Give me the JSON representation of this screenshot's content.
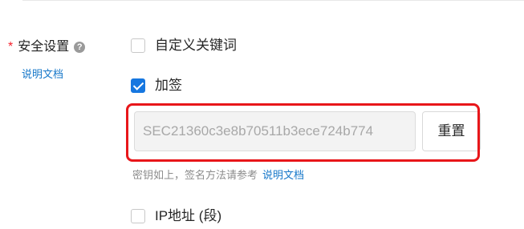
{
  "security_section": {
    "required_mark": "*",
    "label": "安全设置",
    "help_icon": "question-circle-icon",
    "doc_link": "说明文档"
  },
  "options": {
    "custom_keyword": {
      "label": "自定义关键词",
      "checked": false
    },
    "sign": {
      "label": "加签",
      "checked": true
    },
    "ip_address": {
      "label": "IP地址 (段)",
      "checked": false
    }
  },
  "sign_config": {
    "secret_value": "SEC21360c3e8b70511b3ece724b774",
    "reset_label": "重置",
    "hint_text": "密钥如上，签名方法请参考",
    "hint_link": "说明文档"
  },
  "colors": {
    "accent": "#1677e0",
    "link": "#1677c9",
    "required": "#f5222d",
    "highlight": "#e8161a"
  }
}
